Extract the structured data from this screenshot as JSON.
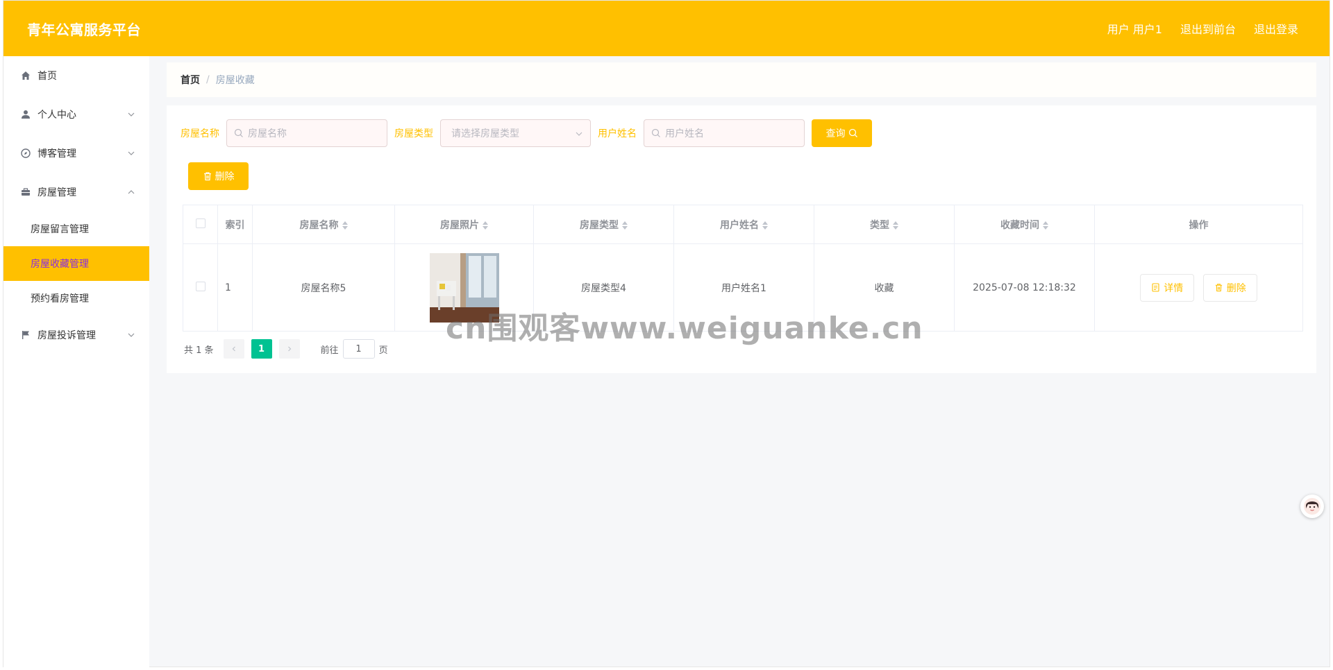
{
  "header": {
    "brand": "青年公寓服务平台",
    "user_label": "用户 用户1",
    "to_front": "退出到前台",
    "logout": "退出登录"
  },
  "sidebar": {
    "items": [
      {
        "label": "首页",
        "icon": "home-icon"
      },
      {
        "label": "个人中心",
        "icon": "user-icon"
      },
      {
        "label": "博客管理",
        "icon": "compass-icon"
      },
      {
        "label": "房屋管理",
        "icon": "briefcase-icon"
      },
      {
        "label": "房屋投诉管理",
        "icon": "flag-icon"
      }
    ],
    "sub_items": [
      {
        "label": "房屋留言管理"
      },
      {
        "label": "房屋收藏管理"
      },
      {
        "label": "预约看房管理"
      }
    ],
    "active": "房屋收藏管理"
  },
  "breadcrumb": {
    "home": "首页",
    "separator": "/",
    "current": "房屋收藏"
  },
  "filters": {
    "house_name_label": "房屋名称",
    "house_name_placeholder": "房屋名称",
    "house_type_label": "房屋类型",
    "house_type_placeholder": "请选择房屋类型",
    "user_name_label": "用户姓名",
    "user_name_placeholder": "用户姓名",
    "query_button": "查询"
  },
  "toolbar": {
    "delete_button": "删除"
  },
  "table": {
    "columns": [
      "索引",
      "房屋名称",
      "房屋照片",
      "房屋类型",
      "用户姓名",
      "类型",
      "收藏时间",
      "操作"
    ],
    "rows": [
      {
        "index": "1",
        "house_name": "房屋名称5",
        "house_type": "房屋类型4",
        "user_name": "用户姓名1",
        "type": "收藏",
        "time": "2025-07-08 12:18:32",
        "detail_btn": "详情",
        "delete_btn": "删除"
      }
    ]
  },
  "pagination": {
    "total": "共 1 条",
    "current_page": "1",
    "goto_label": "前往",
    "goto_value": "1",
    "page_suffix": "页"
  },
  "watermark": "cn围观客www.weiguanke.cn",
  "colors": {
    "accent": "#ffc000",
    "page_active": "#00c292",
    "active_text": "#8a2be2"
  }
}
